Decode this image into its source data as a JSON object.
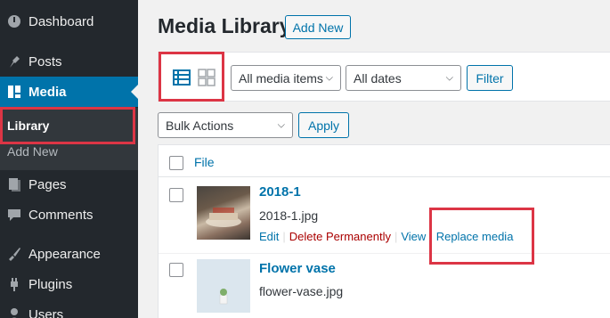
{
  "sidebar": {
    "items": [
      {
        "label": "Dashboard",
        "icon": "dashboard-icon"
      },
      {
        "label": "Posts",
        "icon": "pin-icon"
      },
      {
        "label": "Media",
        "icon": "media-icon"
      },
      {
        "label": "Pages",
        "icon": "pages-icon"
      },
      {
        "label": "Comments",
        "icon": "comments-icon"
      },
      {
        "label": "Appearance",
        "icon": "brush-icon"
      },
      {
        "label": "Plugins",
        "icon": "plugin-icon"
      },
      {
        "label": "Users",
        "icon": "user-icon"
      }
    ],
    "submenu": [
      {
        "label": "Library"
      },
      {
        "label": "Add New"
      }
    ]
  },
  "header": {
    "title": "Media Library",
    "add_new": "Add New"
  },
  "toolbar": {
    "filter_type": "All media items",
    "filter_date": "All dates",
    "filter_button": "Filter"
  },
  "bulk": {
    "action": "Bulk Actions",
    "apply": "Apply"
  },
  "table": {
    "column_file": "File",
    "rows": [
      {
        "title": "2018-1",
        "filename": "2018-1.jpg",
        "actions": {
          "edit": "Edit",
          "delete": "Delete Permanently",
          "view": "View",
          "replace": "Replace media"
        }
      },
      {
        "title": "Flower vase",
        "filename": "flower-vase.jpg"
      }
    ]
  },
  "colors": {
    "accent": "#0073aa",
    "sidebar": "#23282d",
    "highlight": "#dc3545",
    "delete": "#a00"
  }
}
